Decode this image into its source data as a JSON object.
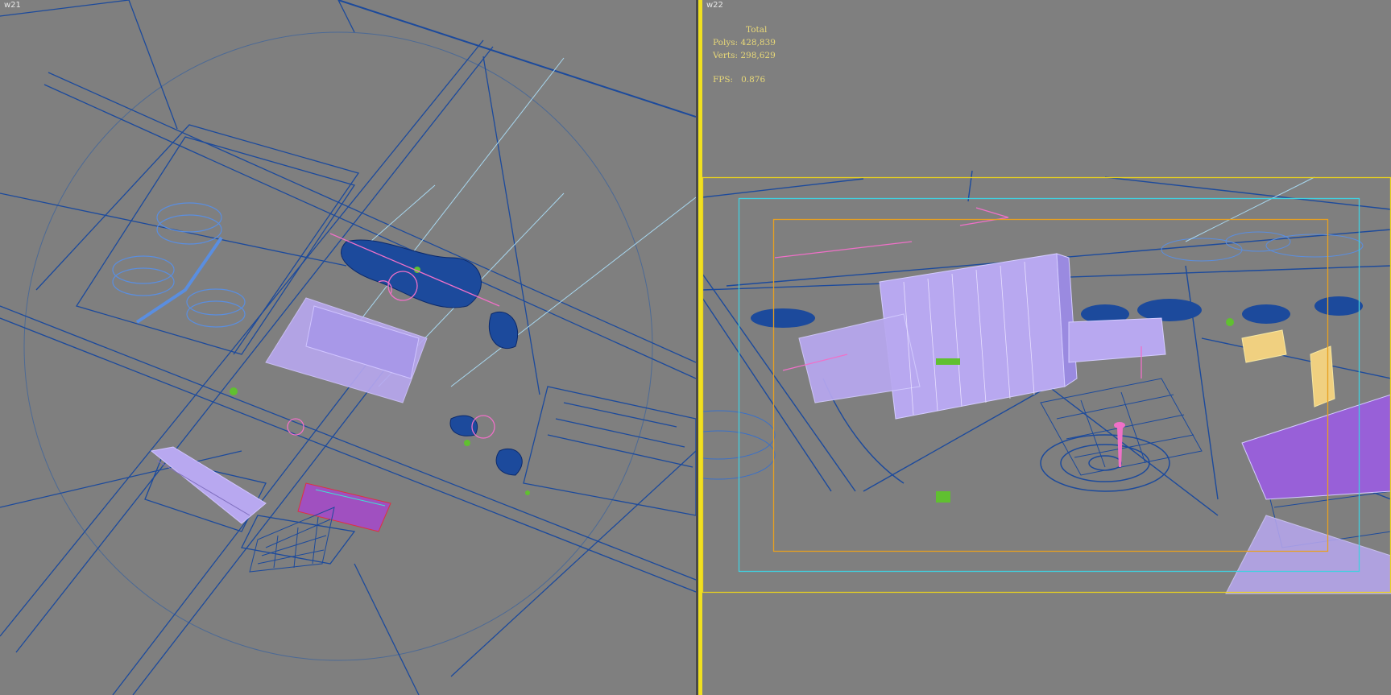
{
  "viewports": {
    "left": {
      "label": "w21"
    },
    "right": {
      "label": "w22"
    }
  },
  "stats": {
    "header": "Total",
    "polys_label": "Polys:",
    "polys_value": "428,839",
    "verts_label": "Verts:",
    "verts_value": "298,629",
    "fps_label": "FPS:",
    "fps_value": "0.876"
  },
  "colors": {
    "background": "#7f7f7f",
    "wire_blue": "#1c4a9c",
    "wire_light_blue": "#5a8ee0",
    "building_lavender": "#b8a8f0",
    "accent_pink": "#f070c8",
    "accent_green": "#60c030",
    "active_border": "#f0e020",
    "safe_frame_outer": "#e8d020",
    "safe_frame_mid": "#40d0e0",
    "safe_frame_inner": "#e8a020"
  }
}
